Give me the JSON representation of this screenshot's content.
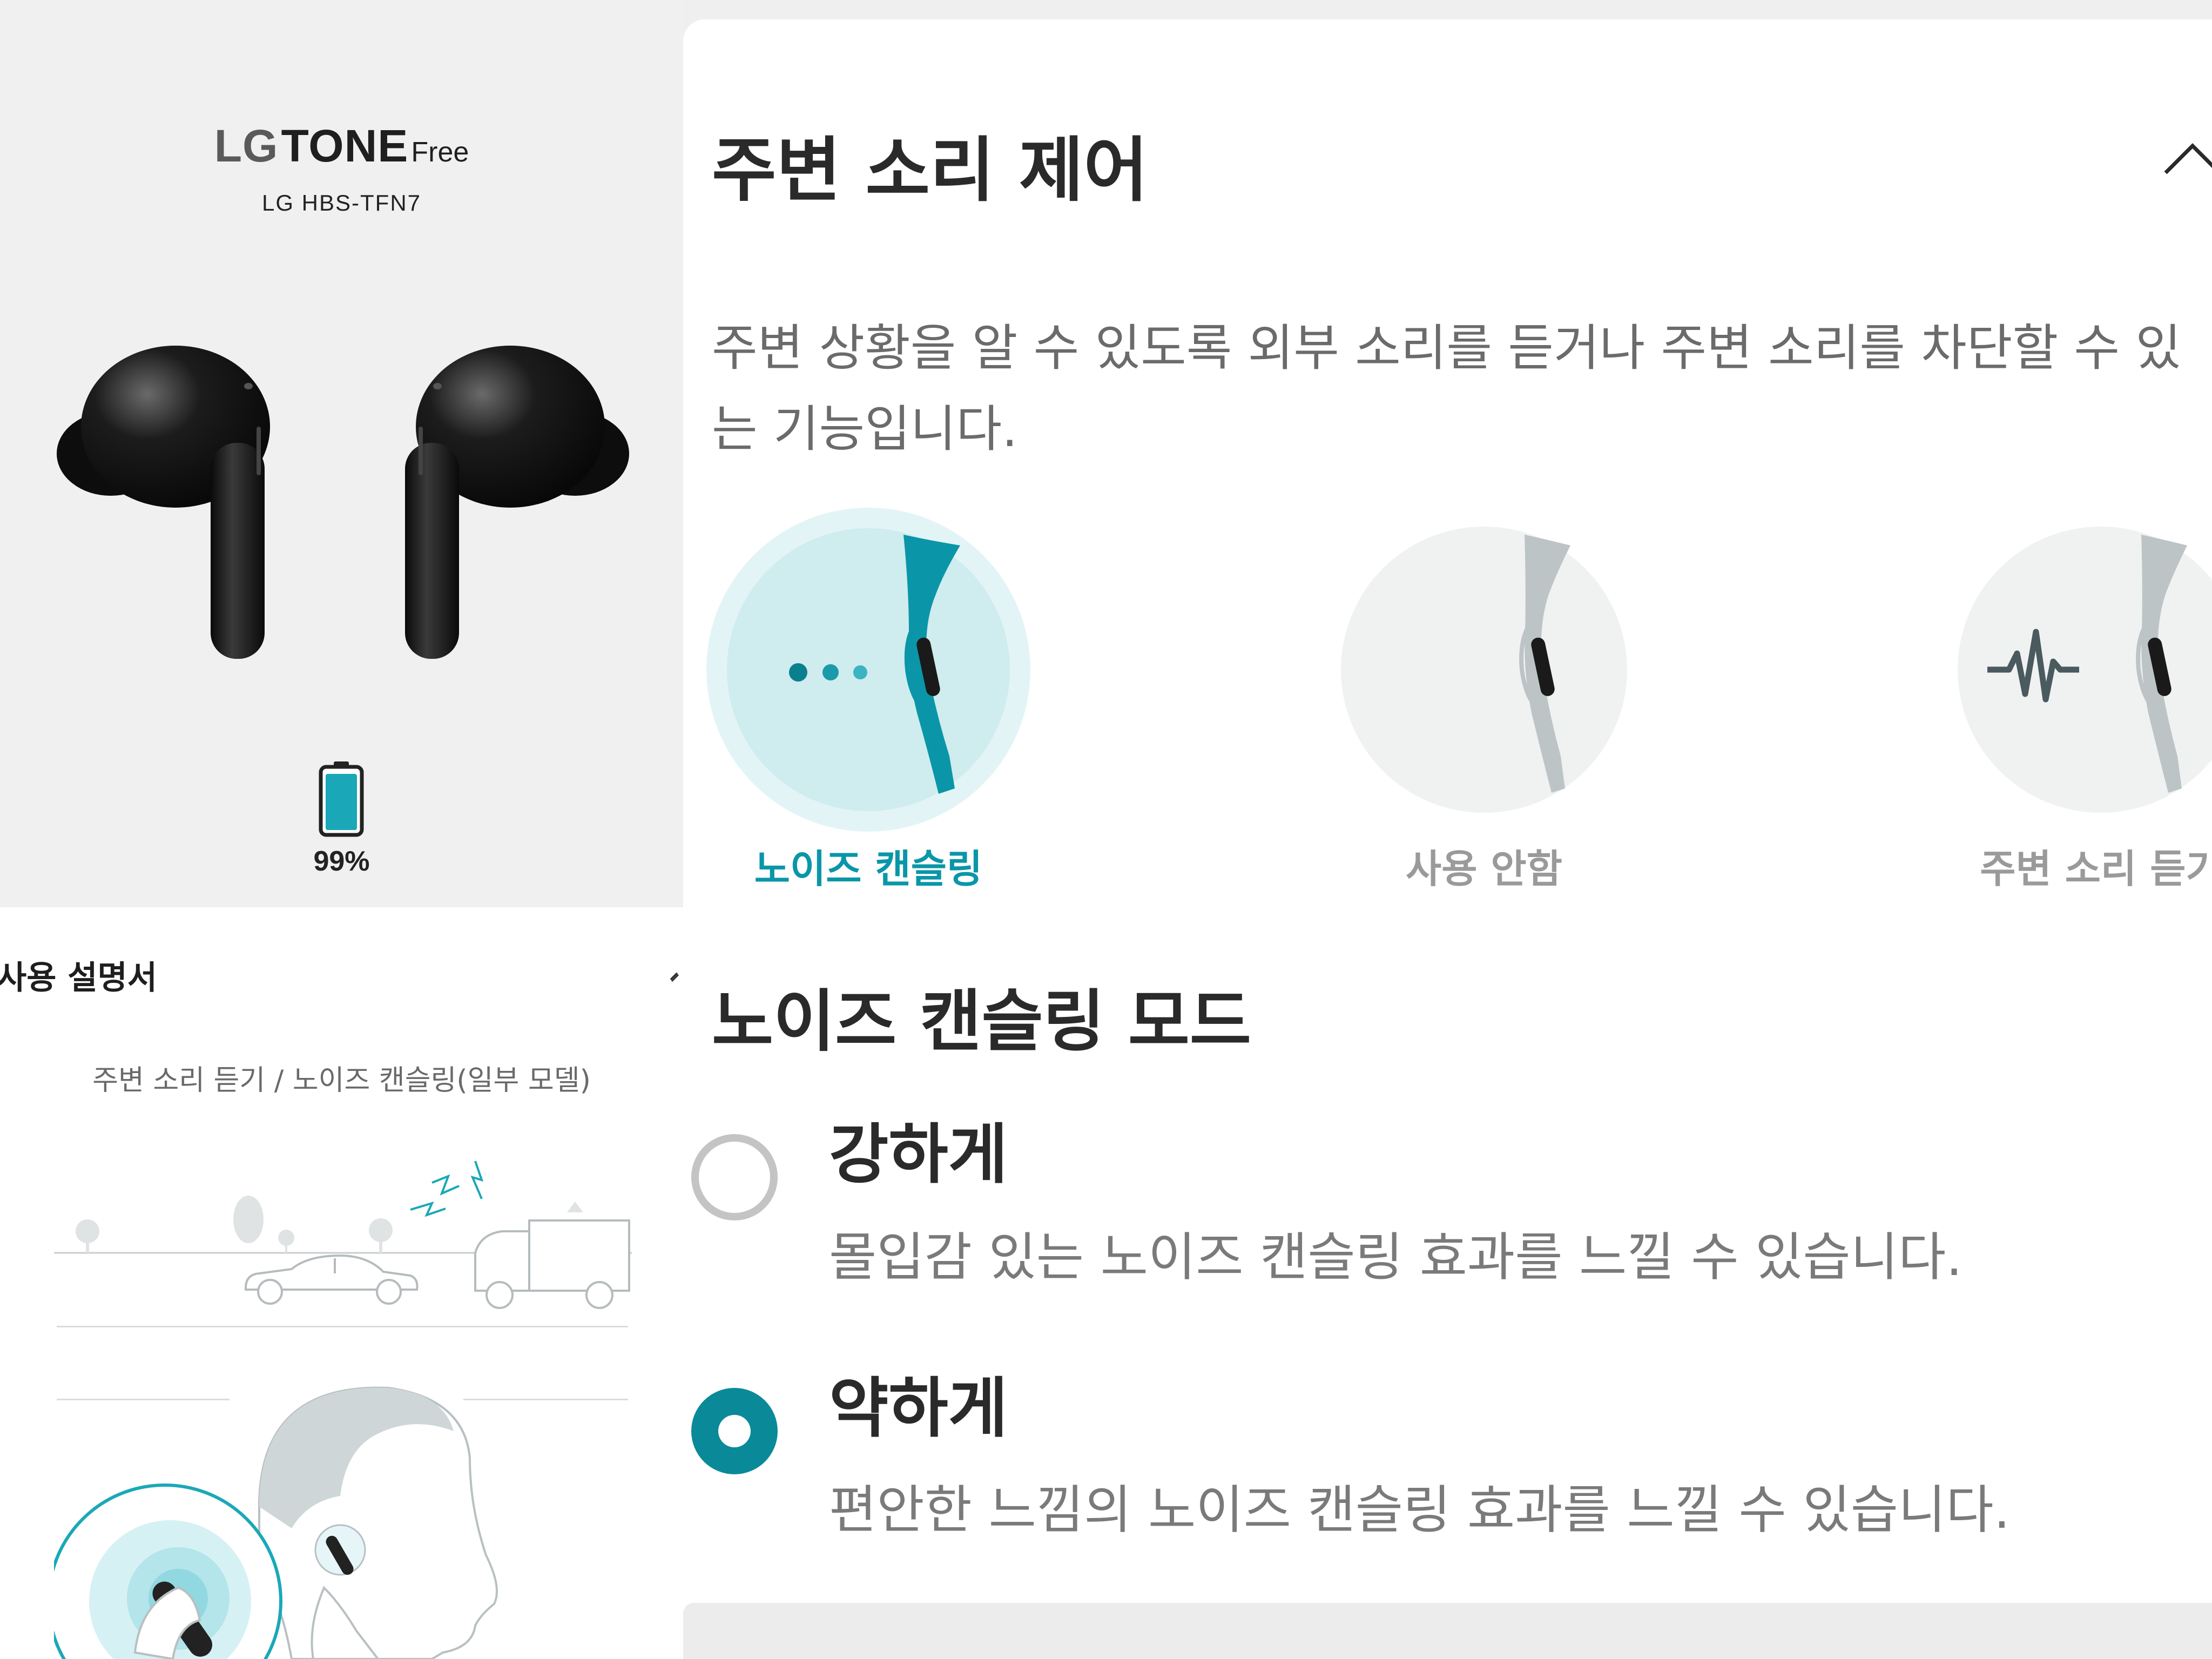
{
  "product": {
    "brand_lg": "LG",
    "brand_tone": "TONE",
    "brand_free": "Free",
    "model": "LG HBS-TFN7",
    "battery_percent": 99,
    "battery_text": "99%",
    "battery_color": "#1aa8b8"
  },
  "ambient_control": {
    "title": "주변 소리 제어",
    "description": "주변 상황을 알 수 있도록 외부 소리를 듣거나 주변 소리를 차단할 수 있는 기능입니다.",
    "collapse_icon": "chevron-up-icon",
    "modes": [
      {
        "label": "노이즈 캔슬링",
        "selected": true
      },
      {
        "label": "사용 안함",
        "selected": false
      },
      {
        "label": "주변 소리 듣기",
        "selected": false
      }
    ],
    "accent_color": "#0a96a8"
  },
  "manual": {
    "title": "사용 설명서",
    "caption": "주변 소리 듣기 / 노이즈 캔슬링(일부 모델)"
  },
  "nc_mode": {
    "title": "노이즈 캔슬링 모드",
    "options": [
      {
        "label": "강하게",
        "description": "몰입감 있는 노이즈 캔슬링 효과를 느낄 수 있습니다.",
        "selected": false
      },
      {
        "label": "약하게",
        "description": "편안한 느낌의 노이즈 캔슬링 효과를 느낄 수 있습니다.",
        "selected": true
      }
    ],
    "radio_color": "#0a8a98"
  }
}
